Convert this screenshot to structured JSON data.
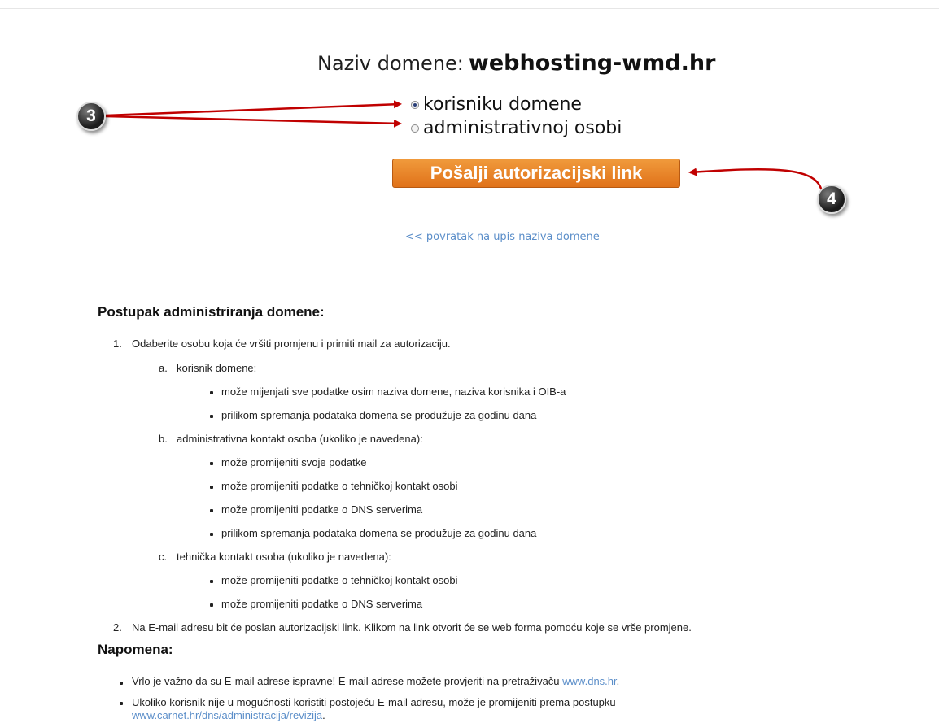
{
  "header": {
    "domain_label": "Naziv domene:",
    "domain_name": "webhosting-wmd.hr"
  },
  "recipient_options": [
    {
      "label": "korisniku domene",
      "selected": true
    },
    {
      "label": "administrativnoj osobi",
      "selected": false
    }
  ],
  "send_button_label": "Pošalji autorizacijski link",
  "back_link_label": "<< povratak na upis naziva domene",
  "annotations": {
    "badge_3": "3",
    "badge_4": "4",
    "arrow_color": "#c00000"
  },
  "procedure": {
    "title": "Postupak administriranja domene:",
    "step1": {
      "num": "1.",
      "text": "Odaberite osobu koja će vršiti promjenu i primiti mail za autorizaciju.",
      "a": {
        "marker": "a.",
        "text": "korisnik domene:",
        "items": [
          "može mijenjati sve podatke osim naziva domene, naziva korisnika i OIB-a",
          "prilikom spremanja podataka domena se produžuje za godinu dana"
        ]
      },
      "b": {
        "marker": "b.",
        "text": "administrativna kontakt osoba (ukoliko je navedena):",
        "items": [
          "može promijeniti svoje podatke",
          "može promijeniti podatke o tehničkoj kontakt osobi",
          "može promijeniti podatke o DNS serverima",
          "prilikom spremanja podataka domena se produžuje za godinu dana"
        ]
      },
      "c": {
        "marker": "c.",
        "text": "tehnička kontakt osoba (ukoliko je navedena):",
        "items": [
          "može promijeniti podatke o tehničkoj kontakt osobi",
          "može promijeniti podatke o DNS serverima"
        ]
      }
    },
    "step2": {
      "num": "2.",
      "text": "Na E-mail adresu bit će poslan autorizacijski link. Klikom na link otvorit će se web forma pomoću koje se vrše promjene."
    }
  },
  "note": {
    "title": "Napomena:",
    "item1_text": "Vrlo je važno da su E-mail adrese ispravne! E-mail adrese možete provjeriti na pretraživaču",
    "item1_link": "www.dns.hr",
    "item1_end": ".",
    "item2_text": "Ukoliko korisnik nije u mogućnosti koristiti postojeću E-mail adresu, može je promijeniti prema postupku",
    "item2_link": "www.carnet.hr/dns/administracija/revizija",
    "item2_end": "."
  }
}
